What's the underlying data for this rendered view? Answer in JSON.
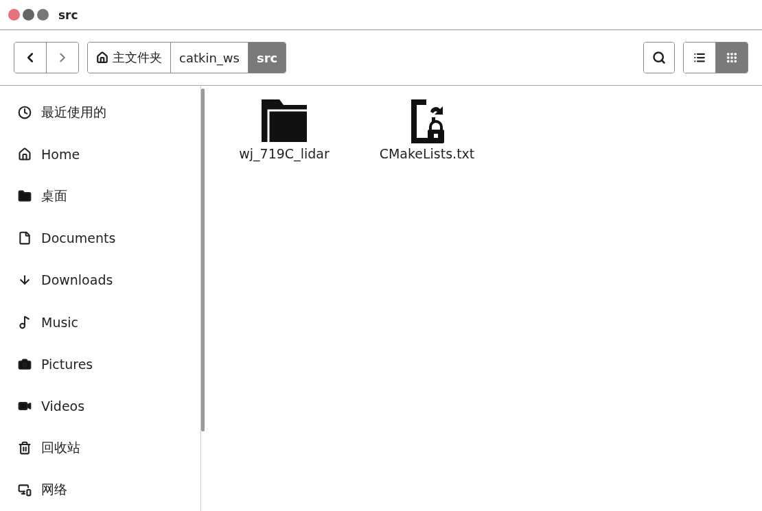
{
  "window": {
    "title": "src"
  },
  "breadcrumbs": [
    {
      "label": "主文件夹",
      "kind": "home",
      "selected": false
    },
    {
      "label": "catkin_ws",
      "kind": "plain",
      "selected": false
    },
    {
      "label": "src",
      "kind": "plain",
      "selected": true
    }
  ],
  "view_modes": [
    {
      "kind": "list",
      "selected": false
    },
    {
      "kind": "grid",
      "selected": true
    }
  ],
  "sidebar": {
    "items": [
      {
        "label": "最近使用的",
        "kind": "recent"
      },
      {
        "label": "Home",
        "kind": "home"
      },
      {
        "label": "桌面",
        "kind": "folder"
      },
      {
        "label": "Documents",
        "kind": "document"
      },
      {
        "label": "Downloads",
        "kind": "download"
      },
      {
        "label": "Music",
        "kind": "music"
      },
      {
        "label": "Pictures",
        "kind": "camera"
      },
      {
        "label": "Videos",
        "kind": "video"
      },
      {
        "label": "回收站",
        "kind": "trash"
      },
      {
        "label": "网络",
        "kind": "network"
      }
    ]
  },
  "files": [
    {
      "name": "wj_719C_lidar",
      "kind": "folder"
    },
    {
      "name": "CMakeLists.txt",
      "kind": "locked-file"
    }
  ]
}
